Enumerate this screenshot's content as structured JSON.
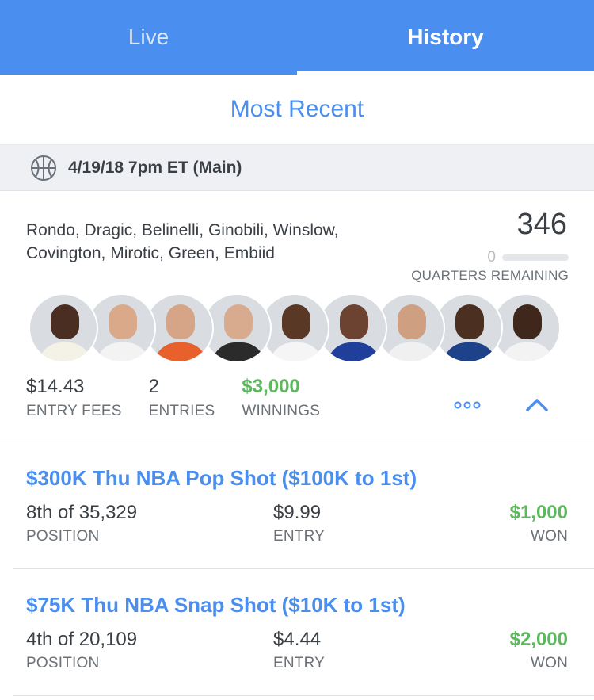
{
  "tabs": [
    {
      "label": "Live",
      "active": false
    },
    {
      "label": "History",
      "active": true
    }
  ],
  "sort": {
    "label": "Most Recent"
  },
  "slate": {
    "icon": "basketball-icon",
    "title": "4/19/18 7pm ET (Main)"
  },
  "lineup": {
    "players_line1": "Rondo, Dragic, Belinelli, Ginobili, Winslow,",
    "players_line2": "Covington, Mirotic, Green, Embiid",
    "score": "346",
    "quarters_remaining_value": "0",
    "quarters_remaining_label": "QUARTERS REMAINING",
    "avatars": [
      {
        "name": "Rondo",
        "skin": "#4a2e22",
        "jersey": "#f4f1e6"
      },
      {
        "name": "Dragic",
        "skin": "#d9a98a",
        "jersey": "#f3f3f3"
      },
      {
        "name": "Belinelli",
        "skin": "#d6a587",
        "jersey": "#e8612c"
      },
      {
        "name": "Ginobili",
        "skin": "#d9ab8e",
        "jersey": "#2b2b2b"
      },
      {
        "name": "Winslow",
        "skin": "#5a3826",
        "jersey": "#f5f5f5"
      },
      {
        "name": "Covington",
        "skin": "#6b4330",
        "jersey": "#1f3f9a"
      },
      {
        "name": "Mirotic",
        "skin": "#cf9f82",
        "jersey": "#f0f0f0"
      },
      {
        "name": "Green",
        "skin": "#4b2f21",
        "jersey": "#1d428a"
      },
      {
        "name": "Embiid",
        "skin": "#3f271c",
        "jersey": "#f3f3f3"
      }
    ],
    "stats": {
      "entry_fees_value": "$14.43",
      "entry_fees_label": "ENTRY FEES",
      "entries_value": "2",
      "entries_label": "ENTRIES",
      "winnings_value": "$3,000",
      "winnings_label": "WINNINGS"
    }
  },
  "contests": [
    {
      "title": "$300K Thu NBA Pop Shot ($100K to 1st)",
      "position_value": "8th of 35,329",
      "position_label": "POSITION",
      "entry_value": "$9.99",
      "entry_label": "ENTRY",
      "won_value": "$1,000",
      "won_label": "WON"
    },
    {
      "title": "$75K Thu NBA Snap Shot ($10K to 1st)",
      "position_value": "4th of 20,109",
      "position_label": "POSITION",
      "entry_value": "$4.44",
      "entry_label": "ENTRY",
      "won_value": "$2,000",
      "won_label": "WON"
    }
  ],
  "colors": {
    "brand_blue": "#4a8ef0",
    "win_green": "#5cb85c",
    "text": "#3a3f45",
    "muted": "#6b7178"
  }
}
